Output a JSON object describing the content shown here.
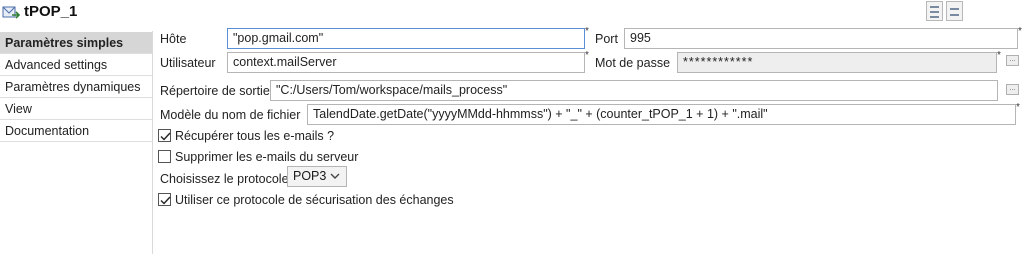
{
  "header": {
    "title": "tPOP_1"
  },
  "sidebar": {
    "items": [
      {
        "label": "Paramètres simples"
      },
      {
        "label": "Advanced settings"
      },
      {
        "label": "Paramètres dynamiques"
      },
      {
        "label": "View"
      },
      {
        "label": "Documentation"
      }
    ],
    "active": "Paramètres simples"
  },
  "form": {
    "host": {
      "label": "Hôte",
      "value": "\"pop.gmail.com\""
    },
    "port": {
      "label": "Port",
      "value": "995"
    },
    "user": {
      "label": "Utilisateur",
      "value": "context.mailServer"
    },
    "password": {
      "label": "Mot de passe",
      "value": "************"
    },
    "output_dir": {
      "label": "Répertoire de sortie",
      "value": "\"C:/Users/Tom/workspace/mails_process\""
    },
    "filename_model": {
      "label": "Modèle du nom de fichier",
      "value": "TalendDate.getDate(\"yyyyMMdd-hhmmss\") + \"_\" + (counter_tPOP_1 + 1) + \".mail\""
    },
    "retrieve_all": {
      "label": "Récupérer tous les e-mails ?",
      "checked": true
    },
    "delete_from_server": {
      "label": "Supprimer les e-mails du serveur",
      "checked": false
    },
    "protocol": {
      "label": "Choisissez le protocole",
      "value": "POP3"
    },
    "use_security": {
      "label": "Utiliser ce protocole de sécurisation des échanges",
      "checked": true
    },
    "required_marker": "*",
    "browse_button_label": "..."
  }
}
